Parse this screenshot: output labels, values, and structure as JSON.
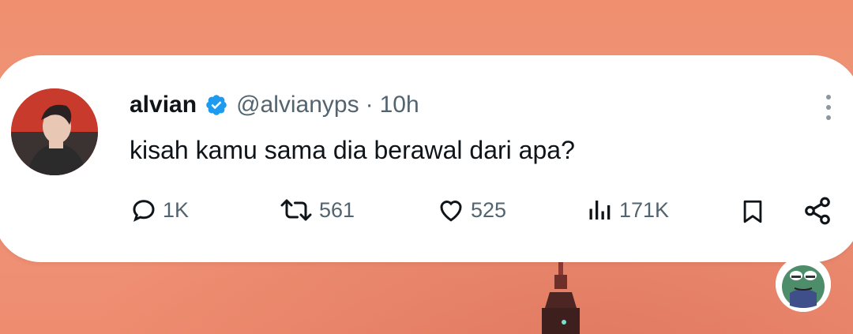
{
  "colors": {
    "background": "#ef8f70",
    "card": "#ffffff",
    "verified_badge": "#1d9bf0",
    "text_primary": "#0f1419",
    "text_secondary": "#536471"
  },
  "tweet": {
    "display_name": "alvian",
    "handle": "@alvianyps",
    "separator": "·",
    "time": "10h",
    "text": "kisah kamu sama dia berawal dari apa?",
    "verified": true
  },
  "actions": {
    "replies": "1K",
    "retweets": "561",
    "likes": "525",
    "views": "171K"
  },
  "icons": {
    "reply": "speech-bubble-icon",
    "retweet": "retweet-arrows-icon",
    "like": "heart-icon",
    "views": "bar-chart-icon",
    "bookmark": "bookmark-icon",
    "share": "share-nodes-icon",
    "more": "vertical-dots-icon",
    "verified": "verified-check-icon"
  }
}
